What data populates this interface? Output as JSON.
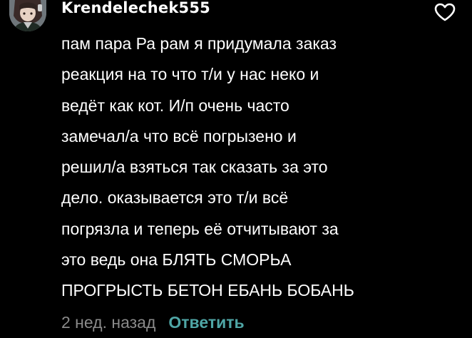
{
  "comment": {
    "username": "Krendelechek555",
    "avatar_icon": "user-avatar",
    "like_icon": "heart-outline-icon",
    "body_lines": [
      "пам пара Ра рам я придумала заказ",
      "реакция на то что т/и у нас неко и",
      "ведёт как кот. И/п очень часто",
      "замечал/а что всё погрызено и",
      "решил/а взяться так сказать за это",
      "дело. оказывается это т/и всё",
      "погрязла и теперь её отчитывают за",
      "это ведь она БЛЯТЬ СМОРЬА",
      "ПРОГРЫСТЬ БЕТОН ЕБАНЬ БОБАНЬ"
    ],
    "timestamp": "2 нед. назад",
    "reply_label": "Ответить"
  },
  "colors": {
    "background": "#000000",
    "text": "#ffffff",
    "meta": "#8a8a8a",
    "reply": "#4fa6a6"
  }
}
